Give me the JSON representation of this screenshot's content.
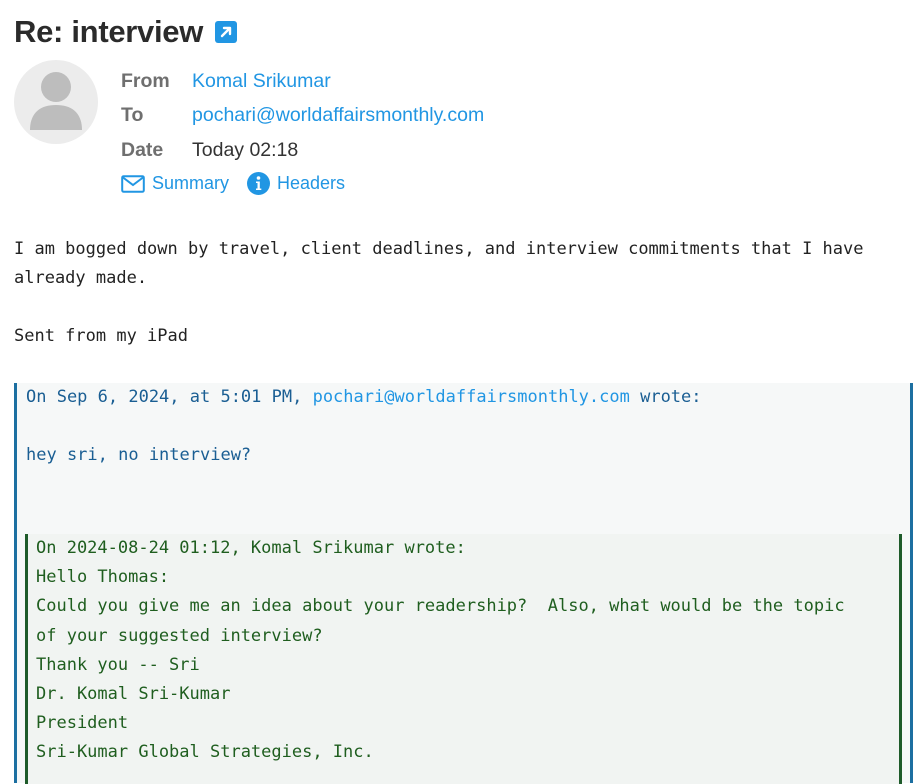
{
  "message": {
    "subject": "Re: interview",
    "from_label": "From",
    "from_value": "Komal Srikumar",
    "to_label": "To",
    "to_value": "pochari@worldaffairsmonthly.com",
    "date_label": "Date",
    "date_value": "Today 02:18"
  },
  "actions": {
    "summary_label": "Summary",
    "headers_label": "Headers"
  },
  "body": {
    "lines": [
      "I am bogged down by travel, client deadlines, and interview commitments that I have",
      "already made.",
      "",
      "Sent from my iPad"
    ]
  },
  "quote1": {
    "attribution_prefix": "On Sep 6, 2024, at 5:01 PM, ",
    "attribution_email": "pochari@worldaffairsmonthly.com",
    "attribution_suffix": " wrote:",
    "text": "hey sri, no interview?"
  },
  "quote2": {
    "lines": [
      "On 2024-08-24 01:12, Komal Srikumar wrote:",
      "Hello Thomas:",
      "Could you give me an idea about your readership?  Also, what would be the topic",
      "of your suggested interview?",
      "Thank you -- Sri",
      "Dr. Komal Sri-Kumar",
      "President",
      "Sri-Kumar Global Strategies, Inc."
    ]
  },
  "icons": {
    "external": "external-link-icon",
    "avatar": "user-placeholder-icon",
    "summary": "envelope-icon",
    "headers": "info-icon"
  },
  "colors": {
    "link": "#2196e3",
    "quote1_border": "#1c6fa1",
    "quote2_border": "#1e5b2a",
    "quote2_text": "#1f5e1f"
  }
}
